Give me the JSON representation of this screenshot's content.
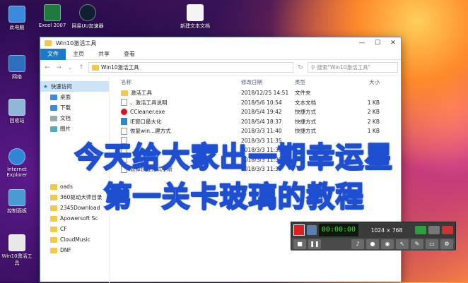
{
  "desktop": {
    "icons": [
      {
        "label": "此电脑",
        "icon": "computer-icon"
      },
      {
        "label": "Excel 2007",
        "icon": "excel-icon"
      },
      {
        "label": "网易UU加速器",
        "icon": "uu-icon"
      },
      {
        "label": "新建文本文档",
        "icon": "text-file-icon"
      },
      {
        "label": "网络",
        "icon": "network-icon"
      },
      {
        "label": "回收站",
        "icon": "recycle-bin-icon"
      },
      {
        "label": "Internet Explorer",
        "icon": "ie-icon"
      },
      {
        "label": "控制面板",
        "icon": "control-panel-icon"
      },
      {
        "label": "Win10激活工具",
        "icon": "tool-icon"
      }
    ]
  },
  "window": {
    "title": "Win10激活工具",
    "controls": {
      "minimize": "—",
      "maximize": "☐",
      "close": "✕"
    },
    "ribbon": {
      "tabs": [
        "文件",
        "主页",
        "共享",
        "查看"
      ],
      "active": 0
    },
    "address": {
      "path": "Win10激活工具",
      "search_placeholder": "搜索\"Win10激活工具\""
    },
    "sidebar": {
      "quick_access": "快速访问",
      "items": [
        "桌面",
        "下载",
        "文档",
        "图片",
        "oads",
        "360驱动大师目录",
        "2345Download",
        "Apowersoft Sc",
        "CF",
        "CloudMusic",
        "DNF"
      ]
    },
    "columns": {
      "name": "名称",
      "date": "修改日期",
      "type": "类型",
      "size": "大小"
    },
    "files": [
      {
        "name": "激活工具",
        "date": "2018/12/25 14:51",
        "type": "文件夹",
        "size": "",
        "icon": "folder-icon"
      },
      {
        "name": "、激活工具说明",
        "date": "2018/5/6 10:54",
        "type": "文本文档",
        "size": "1 KB",
        "icon": "text-file-icon"
      },
      {
        "name": "CCleaner.exe",
        "date": "2018/5/4 19:42",
        "type": "快捷方式",
        "size": "2 KB",
        "icon": "ccleaner-icon"
      },
      {
        "name": "IE窗口最大化",
        "date": "2018/5/4 18:37",
        "type": "快捷方式",
        "size": "2 KB",
        "icon": "ie-icon"
      },
      {
        "name": "恢复win...建方式",
        "date": "2018/3/3 11:40",
        "type": "快捷方式",
        "size": "1 KB",
        "icon": "shortcut-icon"
      },
      {
        "name": "",
        "date": "2018/3/3 11:35",
        "type": "",
        "size": "",
        "icon": "shortcut-icon"
      },
      {
        "name": "",
        "date": "2018/3/3 11:38",
        "type": "",
        "size": "",
        "icon": "shortcut-icon"
      },
      {
        "name": "",
        "date": "2018/3/3 11:38",
        "type": "",
        "size": "",
        "icon": "shortcut-icon"
      },
      {
        "name": "去掉快捷方式小箭",
        "date": "2018/3/3 11:33",
        "type": "",
        "size": "",
        "icon": "shortcut-icon"
      }
    ]
  },
  "caption": {
    "line1": "今天给大家出一期幸运星",
    "line2": "第一关卡玻璃的教程"
  },
  "recorder": {
    "timer": "00:00:00",
    "resolution": "1024 × 768"
  }
}
